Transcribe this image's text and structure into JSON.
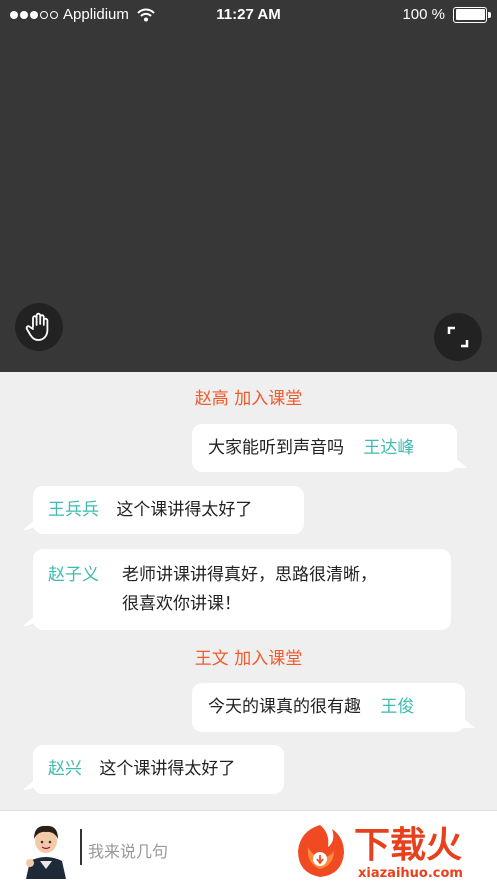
{
  "status_bar": {
    "carrier": "Applidium",
    "time": "11:27 AM",
    "battery": "100 %"
  },
  "video": {
    "hand_icon": "raise-hand-icon",
    "fullscreen_icon": "fullscreen-icon"
  },
  "chat": {
    "join_1": {
      "name": "赵高",
      "action": "加入课堂"
    },
    "msg_1": {
      "text": "大家能听到声音吗",
      "name": "王达峰"
    },
    "msg_2": {
      "name": "王兵兵",
      "text": "这个课讲得太好了"
    },
    "msg_3": {
      "name": "赵子义",
      "line1": "老师讲课讲得真好，思路很清晰，",
      "line2": "很喜欢你讲课！"
    },
    "join_2": {
      "name": "王文",
      "action": "加入课堂"
    },
    "msg_4": {
      "text": "今天的课真的很有趣",
      "name": "王俊"
    },
    "msg_5": {
      "name": "赵兴",
      "text": "这个课讲得太好了"
    }
  },
  "input": {
    "placeholder": "我来说几句"
  },
  "watermark": {
    "title": "下载火",
    "url": "xiazaihuo.com"
  },
  "colors": {
    "accent_orange": "#f25a2c",
    "name_teal": "#3fbab2",
    "video_bg": "#373737",
    "chat_bg": "#efefef"
  }
}
